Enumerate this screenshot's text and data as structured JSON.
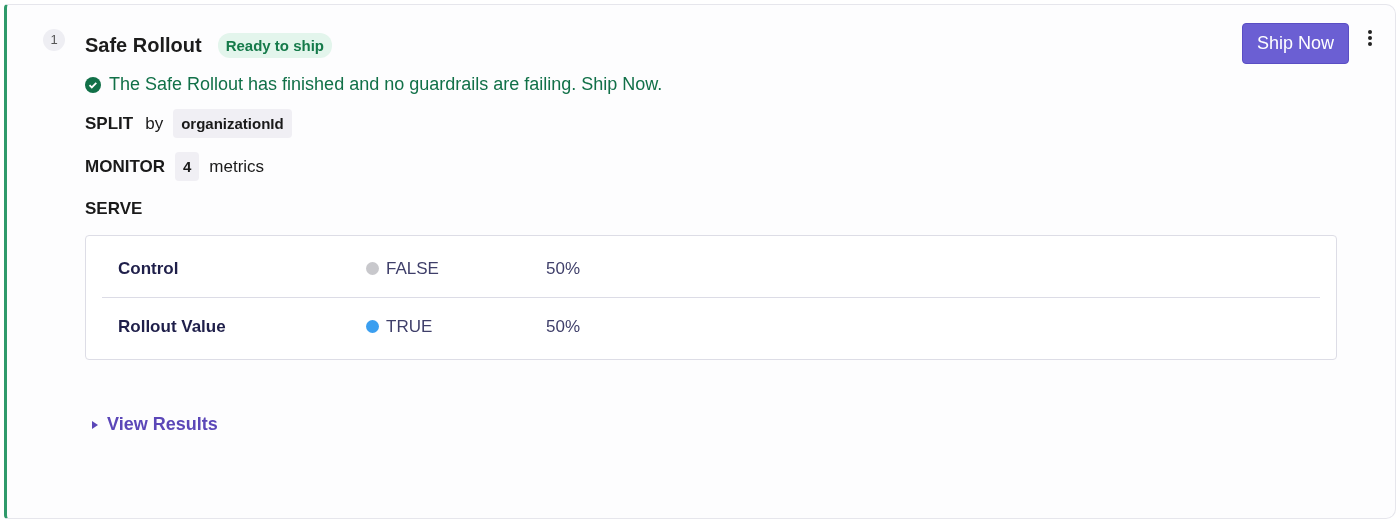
{
  "step": "1",
  "title": "Safe Rollout",
  "status_badge": "Ready to ship",
  "ship_button": "Ship Now",
  "message": "The Safe Rollout has finished and no guardrails are failing. Ship Now.",
  "split": {
    "label": "SPLIT",
    "by": "by",
    "attribute": "organizationId"
  },
  "monitor": {
    "label": "MONITOR",
    "count": "4",
    "unit": "metrics"
  },
  "serve": {
    "label": "SERVE",
    "rows": [
      {
        "name": "Control",
        "value": "FALSE",
        "color": "#c8c8cc",
        "percent": "50%"
      },
      {
        "name": "Rollout Value",
        "value": "TRUE",
        "color": "#3b9ff0",
        "percent": "50%"
      }
    ]
  },
  "view_results": {
    "label": "View Results",
    "expanded": false
  }
}
